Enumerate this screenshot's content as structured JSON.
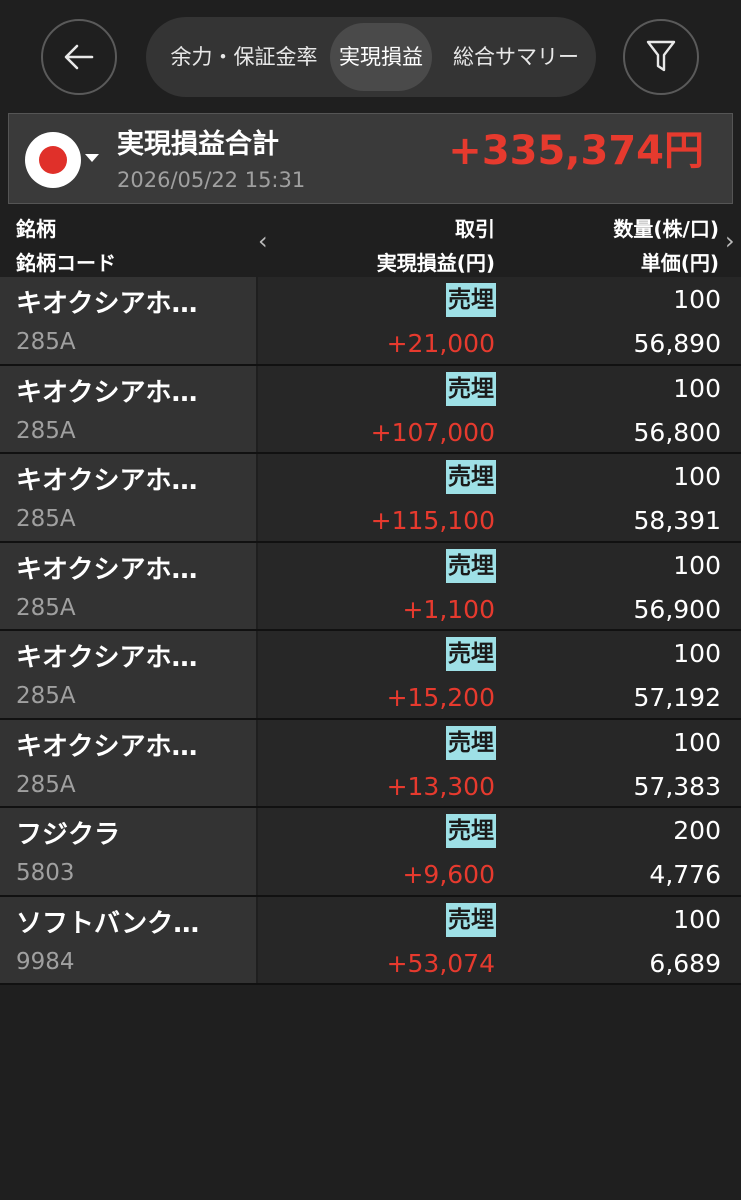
{
  "header": {
    "tabs": [
      {
        "label": "余力・保証金率"
      },
      {
        "label": "実現損益"
      },
      {
        "label": "総合サマリー"
      }
    ],
    "selected_tab": "実現損益",
    "back_icon": "arrow-left-icon",
    "filter_icon": "filter-icon"
  },
  "summary": {
    "title": "実現損益合計",
    "date": "2026/05/22 15:31",
    "amount": "+335,374円",
    "flag_icon": "japan-flag-icon"
  },
  "columns": {
    "left_top": "銘柄",
    "left_bottom": "銘柄コード",
    "mid_top": "取引",
    "mid_bottom": "実現損益(円)",
    "right_top": "数量(株/口)",
    "right_bottom": "単価(円)"
  },
  "rows": [
    {
      "name": "キオクシアホ…",
      "code": "285A",
      "trade": "売埋",
      "pl": "+21,000",
      "qty": "100",
      "price": "56,890"
    },
    {
      "name": "キオクシアホ…",
      "code": "285A",
      "trade": "売埋",
      "pl": "+107,000",
      "qty": "100",
      "price": "56,800"
    },
    {
      "name": "キオクシアホ…",
      "code": "285A",
      "trade": "売埋",
      "pl": "+115,100",
      "qty": "100",
      "price": "58,391"
    },
    {
      "name": "キオクシアホ…",
      "code": "285A",
      "trade": "売埋",
      "pl": "+1,100",
      "qty": "100",
      "price": "56,900"
    },
    {
      "name": "キオクシアホ…",
      "code": "285A",
      "trade": "売埋",
      "pl": "+15,200",
      "qty": "100",
      "price": "57,192"
    },
    {
      "name": "キオクシアホ…",
      "code": "285A",
      "trade": "売埋",
      "pl": "+13,300",
      "qty": "100",
      "price": "57,383"
    },
    {
      "name": "フジクラ",
      "code": "5803",
      "trade": "売埋",
      "pl": "+9,600",
      "qty": "200",
      "price": "4,776"
    },
    {
      "name": "ソフトバンク…",
      "code": "9984",
      "trade": "売埋",
      "pl": "+53,074",
      "qty": "100",
      "price": "6,689"
    }
  ],
  "colors": {
    "background": "#1f1f1f",
    "profit": "#e63a2e",
    "trade_badge": "#9ee0e6"
  }
}
